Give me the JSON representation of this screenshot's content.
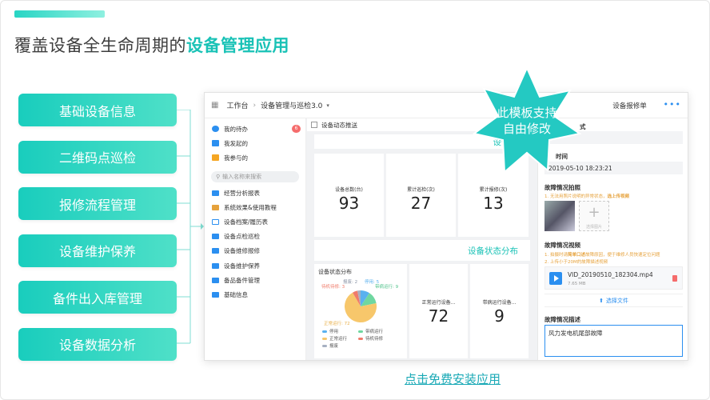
{
  "headline": {
    "prefix": "覆盖设备全生命周期的",
    "highlight": "设备管理应用"
  },
  "features": [
    "基础设备信息",
    "二维码点巡检",
    "报修流程管理",
    "设备维护保养",
    "备件出入库管理",
    "设备数据分析"
  ],
  "screenshot": {
    "breadcrumb": {
      "root": "工作台",
      "current": "设备管理与巡检3.0"
    },
    "sidebar": {
      "todo": "我的待办",
      "todo_badge": "6",
      "initiated": "我发起的",
      "involved": "我参与的",
      "search_placeholder": "输入名称来搜索",
      "nav": [
        "经营分析报表",
        "系统效果&使用教程",
        "设备档案/履历表",
        "设备点检巡检",
        "设备维修报修",
        "设备维护保养",
        "备品备件管理",
        "基础信息"
      ]
    },
    "main": {
      "subhead": "设备动态推送",
      "strip1_title": "设备动",
      "stats": [
        {
          "label": "设备总数(台)",
          "value": "93"
        },
        {
          "label": "累计巡检(次)",
          "value": "27"
        },
        {
          "label": "累计报修(次)",
          "value": "13"
        }
      ],
      "strip2_title": "设备状态分布",
      "pie_title": "设备状态分布",
      "pie_labels": [
        "报废: 2",
        "停用: 5",
        "待机待修: 3",
        "带病运行: 9",
        "正常运行: 72"
      ],
      "legend": [
        "停用",
        "带病运行",
        "正常运行",
        "待机待修",
        "报废"
      ],
      "stats2": [
        {
          "label": "正常运行设备...",
          "value": "72"
        },
        {
          "label": "带病运行设备...",
          "value": "9"
        }
      ]
    },
    "right_panel": {
      "title": "设备报修单",
      "field1_label": "式",
      "field2_label": "时间",
      "datetime": "2019-05-10 18:23:21",
      "photo_label": "故障情况拍照",
      "photo_hint_prefix": "1. 无法用照片说明的异常状态，",
      "photo_hint_bold": "选上传视频",
      "photo_add": "选择图片",
      "video_label": "故障情况视频",
      "video_hint1_prefix": "1. 拍摄时请",
      "video_hint1_bold": "简单口述",
      "video_hint1_suffix": "故障原因，便于维修人员快速定位问题",
      "video_hint2": "2. 上传小于20M的故障描述视频",
      "video_name": "VID_20190510_182304.mp4",
      "video_size": "7.65 MB",
      "choose_file": "选择文件",
      "desc_label": "故障情况描述",
      "desc_value": "风力发电机尾部故障"
    }
  },
  "star_badge": {
    "line1": "此模板支持",
    "line2": "自由修改"
  },
  "install_link": "点击免费安装应用",
  "colors": {
    "accent": "#19c2b6",
    "blue": "#2b8ff0"
  }
}
